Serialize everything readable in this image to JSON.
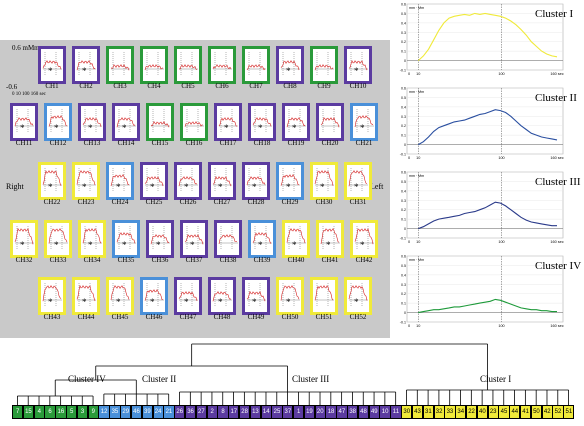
{
  "colors": {
    "I": "#f0ea3a",
    "II": "#4a90d9",
    "III": "#5b3ba0",
    "IV": "#2a9a3a"
  },
  "grid": {
    "scale_label": "0.6 mMmm",
    "scale_low": "-0.6",
    "scale_ticks": "0 10 100 160 sec",
    "right_label": "Right",
    "left_label": "Left",
    "channels": [
      {
        "label": "CH1",
        "cluster": "III",
        "star": true
      },
      {
        "label": "CH2",
        "cluster": "III",
        "star": true
      },
      {
        "label": "CH3",
        "cluster": "IV",
        "star": false
      },
      {
        "label": "CH4",
        "cluster": "IV",
        "star": false
      },
      {
        "label": "CH5",
        "cluster": "IV",
        "star": false
      },
      {
        "label": "CH6",
        "cluster": "IV",
        "star": false
      },
      {
        "label": "CH7",
        "cluster": "IV",
        "star": false
      },
      {
        "label": "CH8",
        "cluster": "III",
        "star": true
      },
      {
        "label": "CH9",
        "cluster": "IV",
        "star": false
      },
      {
        "label": "CH10",
        "cluster": "III",
        "star": true
      },
      {
        "label": "CH11",
        "cluster": "III",
        "star": true
      },
      {
        "label": "CH12",
        "cluster": "II",
        "star": true
      },
      {
        "label": "CH13",
        "cluster": "III",
        "star": true
      },
      {
        "label": "CH14",
        "cluster": "III",
        "star": true
      },
      {
        "label": "CH15",
        "cluster": "IV",
        "star": false
      },
      {
        "label": "CH16",
        "cluster": "IV",
        "star": false
      },
      {
        "label": "CH17",
        "cluster": "III",
        "star": true
      },
      {
        "label": "CH18",
        "cluster": "III",
        "star": true
      },
      {
        "label": "CH19",
        "cluster": "III",
        "star": true
      },
      {
        "label": "CH20",
        "cluster": "III",
        "star": false
      },
      {
        "label": "CH21",
        "cluster": "II",
        "star": true
      },
      {
        "label": "CH22",
        "cluster": "I",
        "star": true
      },
      {
        "label": "CH23",
        "cluster": "I",
        "star": true
      },
      {
        "label": "CH24",
        "cluster": "II",
        "star": true
      },
      {
        "label": "CH25",
        "cluster": "III",
        "star": true
      },
      {
        "label": "CH26",
        "cluster": "III",
        "star": true
      },
      {
        "label": "CH27",
        "cluster": "III",
        "star": true
      },
      {
        "label": "CH28",
        "cluster": "III",
        "star": true
      },
      {
        "label": "CH29",
        "cluster": "II",
        "star": true
      },
      {
        "label": "CH30",
        "cluster": "I",
        "star": true
      },
      {
        "label": "CH31",
        "cluster": "I",
        "star": true
      },
      {
        "label": "CH32",
        "cluster": "I",
        "star": true
      },
      {
        "label": "CH33",
        "cluster": "I",
        "star": true
      },
      {
        "label": "CH34",
        "cluster": "I",
        "star": true
      },
      {
        "label": "CH35",
        "cluster": "II",
        "star": true
      },
      {
        "label": "CH36",
        "cluster": "III",
        "star": true
      },
      {
        "label": "CH37",
        "cluster": "III",
        "star": true
      },
      {
        "label": "CH38",
        "cluster": "III",
        "star": false
      },
      {
        "label": "CH39",
        "cluster": "II",
        "star": true
      },
      {
        "label": "CH40",
        "cluster": "I",
        "star": true
      },
      {
        "label": "CH41",
        "cluster": "I",
        "star": true
      },
      {
        "label": "CH42",
        "cluster": "I",
        "star": true
      },
      {
        "label": "CH43",
        "cluster": "I",
        "star": true
      },
      {
        "label": "CH44",
        "cluster": "I",
        "star": true
      },
      {
        "label": "CH45",
        "cluster": "I",
        "star": true
      },
      {
        "label": "CH46",
        "cluster": "II",
        "star": true
      },
      {
        "label": "CH47",
        "cluster": "III",
        "star": true
      },
      {
        "label": "CH48",
        "cluster": "III",
        "star": true
      },
      {
        "label": "CH49",
        "cluster": "III",
        "star": true
      },
      {
        "label": "CH50",
        "cluster": "I",
        "star": true
      },
      {
        "label": "CH51",
        "cluster": "I",
        "star": false
      },
      {
        "label": "CH52",
        "cluster": "I",
        "star": true
      }
    ]
  },
  "signals": [
    {
      "cluster": "I",
      "title": "Cluster I",
      "color": "#f0ea3a",
      "ylabel": "mm · Mm",
      "yticks": [
        "0.6",
        "0.5",
        "0.4",
        "0.3",
        "0.2",
        "0.1",
        "0",
        "-0.1"
      ],
      "xticks": [
        "0",
        "10",
        "100",
        "160 sec"
      ],
      "values": [
        0.0,
        0.05,
        0.12,
        0.22,
        0.32,
        0.4,
        0.45,
        0.47,
        0.48,
        0.49,
        0.48,
        0.5,
        0.49,
        0.5,
        0.49,
        0.48,
        0.47,
        0.45,
        0.42,
        0.38,
        0.33,
        0.27,
        0.2,
        0.15,
        0.1,
        0.07,
        0.05,
        0.04
      ]
    },
    {
      "cluster": "II",
      "title": "Cluster II",
      "color": "#2a4fa0",
      "ylabel": "mm · Mm",
      "yticks": [
        "0.6",
        "0.5",
        "0.4",
        "0.3",
        "0.2",
        "0.1",
        "0",
        "-0.1"
      ],
      "xticks": [
        "0",
        "10",
        "100",
        "160 sec"
      ],
      "values": [
        0.0,
        0.03,
        0.08,
        0.14,
        0.18,
        0.2,
        0.22,
        0.24,
        0.25,
        0.26,
        0.28,
        0.3,
        0.32,
        0.33,
        0.35,
        0.37,
        0.36,
        0.34,
        0.3,
        0.25,
        0.2,
        0.16,
        0.12,
        0.1,
        0.08,
        0.07,
        0.06,
        0.05
      ]
    },
    {
      "cluster": "III",
      "title": "Cluster III",
      "color": "#2a3a8a",
      "ylabel": "mm · Mm",
      "yticks": [
        "0.6",
        "0.5",
        "0.4",
        "0.3",
        "0.2",
        "0.1",
        "0",
        "-0.1"
      ],
      "xticks": [
        "0",
        "10",
        "100",
        "160 sec"
      ],
      "values": [
        0.0,
        0.02,
        0.05,
        0.08,
        0.1,
        0.11,
        0.12,
        0.13,
        0.14,
        0.16,
        0.17,
        0.18,
        0.2,
        0.22,
        0.25,
        0.28,
        0.27,
        0.24,
        0.2,
        0.16,
        0.12,
        0.09,
        0.07,
        0.06,
        0.05,
        0.04,
        0.03,
        0.03
      ]
    },
    {
      "cluster": "IV",
      "title": "Cluster IV",
      "color": "#1e9a3a",
      "ylabel": "mm · Mm",
      "yticks": [
        "0.6",
        "0.5",
        "0.4",
        "0.3",
        "0.2",
        "0.1",
        "0",
        "-0.1"
      ],
      "xticks": [
        "0",
        "10",
        "100",
        "160 sec"
      ],
      "values": [
        0.0,
        0.01,
        0.02,
        0.03,
        0.03,
        0.04,
        0.05,
        0.06,
        0.06,
        0.07,
        0.08,
        0.09,
        0.1,
        0.11,
        0.12,
        0.14,
        0.13,
        0.11,
        0.09,
        0.07,
        0.05,
        0.04,
        0.03,
        0.03,
        0.02,
        0.02,
        0.01,
        0.01
      ]
    }
  ],
  "dendrogram": {
    "labels": [
      {
        "text": "Cluster IV",
        "cluster": "IV"
      },
      {
        "text": "Cluster II",
        "cluster": "II"
      },
      {
        "text": "Cluster III",
        "cluster": "III"
      },
      {
        "text": "Cluster I",
        "cluster": "I"
      }
    ],
    "leaves": [
      {
        "n": "7",
        "c": "IV"
      },
      {
        "n": "15",
        "c": "IV"
      },
      {
        "n": "4",
        "c": "IV"
      },
      {
        "n": "6",
        "c": "IV"
      },
      {
        "n": "16",
        "c": "IV"
      },
      {
        "n": "5",
        "c": "IV"
      },
      {
        "n": "3",
        "c": "IV"
      },
      {
        "n": "9",
        "c": "IV"
      },
      {
        "n": "12",
        "c": "II"
      },
      {
        "n": "35",
        "c": "II"
      },
      {
        "n": "29",
        "c": "II"
      },
      {
        "n": "46",
        "c": "II"
      },
      {
        "n": "39",
        "c": "II"
      },
      {
        "n": "24",
        "c": "II"
      },
      {
        "n": "21",
        "c": "II"
      },
      {
        "n": "26",
        "c": "III"
      },
      {
        "n": "36",
        "c": "III"
      },
      {
        "n": "27",
        "c": "III"
      },
      {
        "n": "2",
        "c": "III"
      },
      {
        "n": "8",
        "c": "III"
      },
      {
        "n": "17",
        "c": "III"
      },
      {
        "n": "28",
        "c": "III"
      },
      {
        "n": "13",
        "c": "III"
      },
      {
        "n": "14",
        "c": "III"
      },
      {
        "n": "25",
        "c": "III"
      },
      {
        "n": "37",
        "c": "III"
      },
      {
        "n": "1",
        "c": "III"
      },
      {
        "n": "19",
        "c": "III"
      },
      {
        "n": "20",
        "c": "III"
      },
      {
        "n": "18",
        "c": "III"
      },
      {
        "n": "47",
        "c": "III"
      },
      {
        "n": "38",
        "c": "III"
      },
      {
        "n": "48",
        "c": "III"
      },
      {
        "n": "49",
        "c": "III"
      },
      {
        "n": "10",
        "c": "III"
      },
      {
        "n": "11",
        "c": "III"
      },
      {
        "n": "30",
        "c": "I"
      },
      {
        "n": "43",
        "c": "I"
      },
      {
        "n": "31",
        "c": "I"
      },
      {
        "n": "32",
        "c": "I"
      },
      {
        "n": "33",
        "c": "I"
      },
      {
        "n": "34",
        "c": "I"
      },
      {
        "n": "22",
        "c": "I"
      },
      {
        "n": "40",
        "c": "I"
      },
      {
        "n": "23",
        "c": "I"
      },
      {
        "n": "45",
        "c": "I"
      },
      {
        "n": "44",
        "c": "I"
      },
      {
        "n": "41",
        "c": "I"
      },
      {
        "n": "50",
        "c": "I"
      },
      {
        "n": "42",
        "c": "I"
      },
      {
        "n": "52",
        "c": "I"
      },
      {
        "n": "51",
        "c": "I"
      }
    ]
  }
}
